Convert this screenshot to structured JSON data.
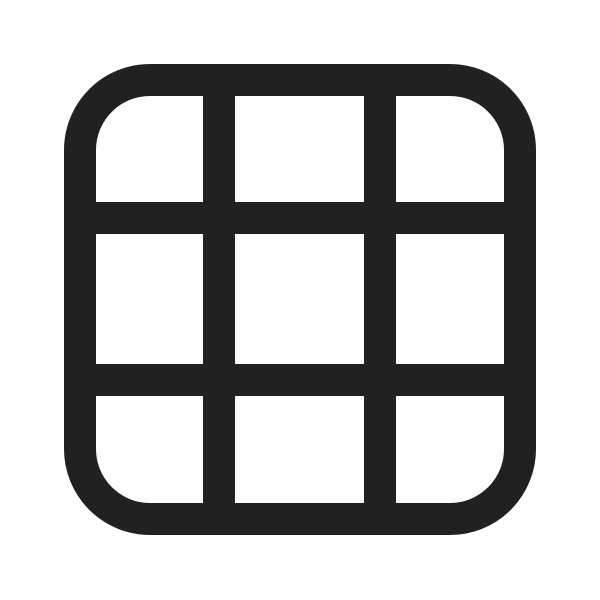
{
  "icon": {
    "name": "grid-icon",
    "rows": 3,
    "columns": 3,
    "stroke_color": "#212121",
    "background_color": "#ffffff"
  }
}
